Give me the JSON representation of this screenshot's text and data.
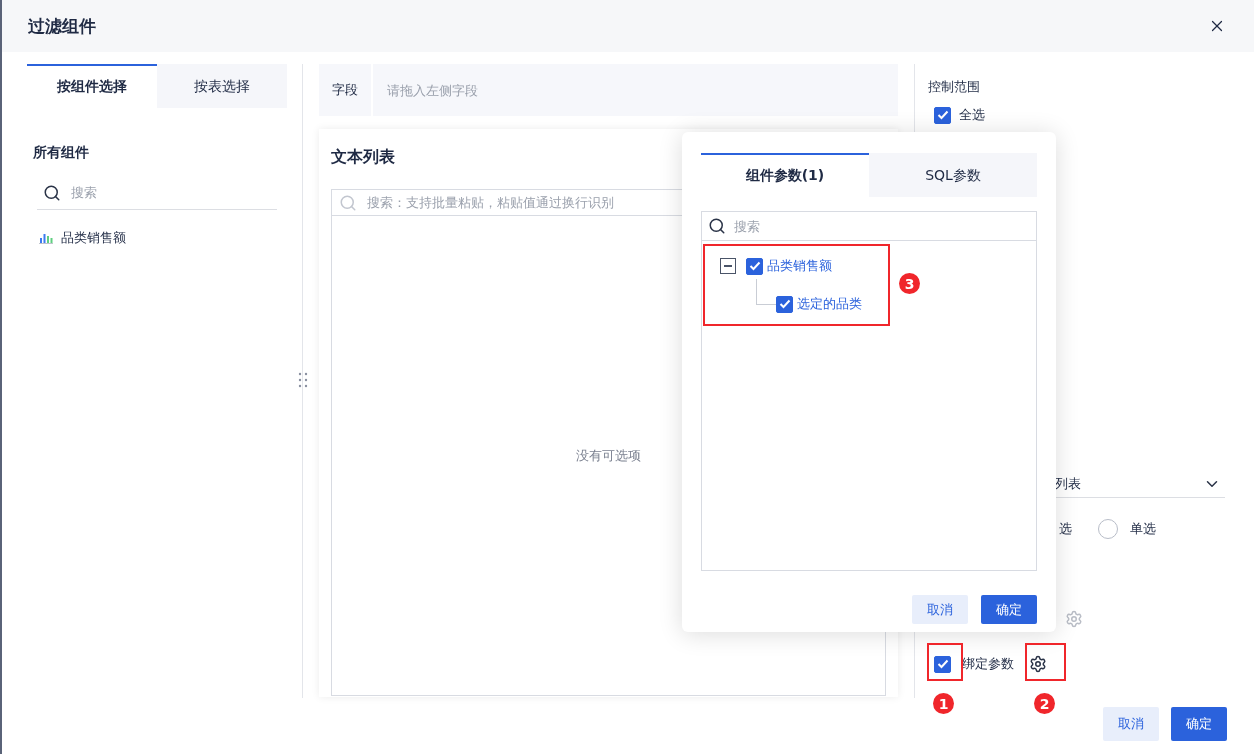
{
  "dialog": {
    "title": "过滤组件"
  },
  "left_panel": {
    "tabs": [
      {
        "label": "按组件选择",
        "selected": true
      },
      {
        "label": "按表选择",
        "selected": false
      }
    ],
    "section_title": "所有组件",
    "search": {
      "placeholder": "搜索"
    },
    "components": [
      {
        "label": "品类销售额"
      }
    ]
  },
  "field_bar": {
    "label": "字段",
    "placeholder": "请拖入左侧字段"
  },
  "preview": {
    "title": "文本列表",
    "search": {
      "placeholder": "搜索：支持批量粘贴，粘贴值通过换行识别"
    },
    "empty_text": "没有可选项"
  },
  "right_panel": {
    "section_title": "控制范围",
    "select_all": {
      "label": "全选",
      "checked": true
    },
    "display_type": {
      "value": "列表"
    },
    "mode_text": "选",
    "single_option": {
      "label": "单选",
      "selected": false
    },
    "bind_param": {
      "label": "绑定参数",
      "checked": true
    }
  },
  "footer": {
    "buttons": [
      {
        "label": "取消",
        "kind": "secondary"
      },
      {
        "label": "确定",
        "kind": "primary"
      }
    ]
  },
  "popover": {
    "tabs": [
      {
        "label": "组件参数(1)",
        "selected": true
      },
      {
        "label": "SQL参数",
        "selected": false
      }
    ],
    "search": {
      "placeholder": "搜索"
    },
    "tree": [
      {
        "label": "品类销售额",
        "checked": true,
        "expanded": true,
        "children": [
          {
            "label": "选定的品类",
            "checked": true
          }
        ]
      }
    ],
    "buttons": [
      {
        "label": "取消",
        "kind": "secondary"
      },
      {
        "label": "确定",
        "kind": "primary"
      }
    ]
  },
  "annotations": [
    {
      "label": "1"
    },
    {
      "label": "2"
    },
    {
      "label": "3"
    }
  ]
}
